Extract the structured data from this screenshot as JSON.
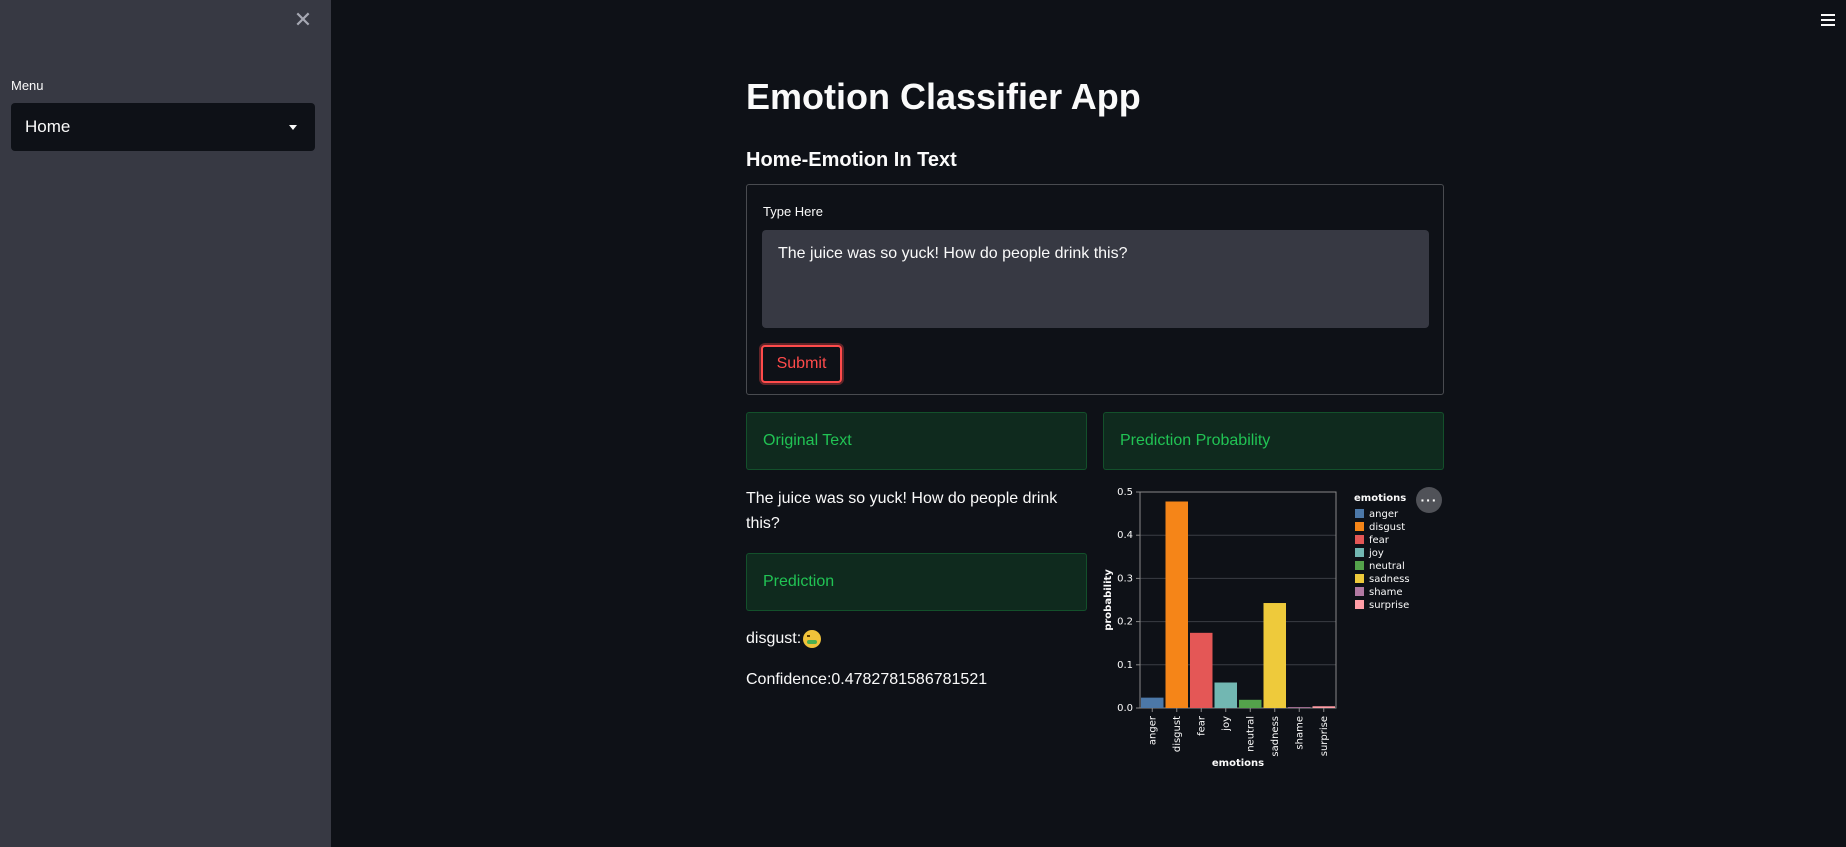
{
  "sidebar": {
    "close_icon": "close-icon",
    "menu_label": "Menu",
    "menu_selected": "Home"
  },
  "main": {
    "title": "Emotion Classifier App",
    "subtitle": "Home-Emotion In Text",
    "form": {
      "input_label": "Type Here",
      "input_value": "The juice was so yuck! How do people drink this?",
      "submit_label": "Submit"
    },
    "original_text_header": "Original Text",
    "original_text": "The juice was so yuck! How do people drink this?",
    "prediction_header": "Prediction",
    "prediction_label": "disgust:",
    "prediction_emoji": "nauseated-face-icon",
    "confidence": "Confidence:0.4782781586781521",
    "probability_header": "Prediction Probability"
  },
  "colors": {
    "accent": "#ff4b4b",
    "success_text": "#21c354",
    "background": "#0e1117",
    "sidebar": "#373943"
  },
  "chart_data": {
    "type": "bar",
    "xlabel": "emotions",
    "ylabel": "probability",
    "ylim": [
      0,
      0.5
    ],
    "yticks": [
      "0.0",
      "0.1",
      "0.2",
      "0.3",
      "0.4",
      "0.5"
    ],
    "grid": true,
    "legend_title": "emotions",
    "legend_placement": "right",
    "categories": [
      "anger",
      "disgust",
      "fear",
      "joy",
      "neutral",
      "sadness",
      "shame",
      "surprise"
    ],
    "values": [
      0.024,
      0.478,
      0.174,
      0.059,
      0.019,
      0.243,
      0.002,
      0.004
    ],
    "colors": [
      "#4c78a8",
      "#f58518",
      "#e45756",
      "#72b7b2",
      "#54a24b",
      "#eeca3b",
      "#b279a2",
      "#ff9da6"
    ]
  }
}
